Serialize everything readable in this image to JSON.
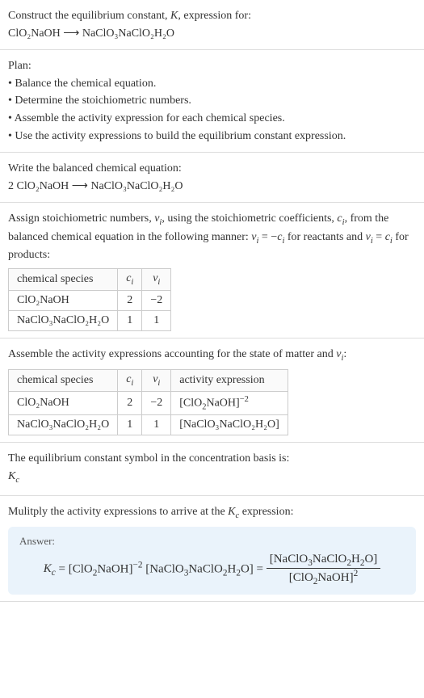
{
  "s1": {
    "l1": "Construct the equilibrium constant, K, expression for:",
    "l2": "ClO₂NaOH ⟶ NaClO₃NaClO₂H₂O"
  },
  "s2": {
    "l1": "Plan:",
    "l2": "• Balance the chemical equation.",
    "l3": "• Determine the stoichiometric numbers.",
    "l4": "• Assemble the activity expression for each chemical species.",
    "l5": "• Use the activity expressions to build the equilibrium constant expression."
  },
  "s3": {
    "l1": "Write the balanced chemical equation:",
    "l2": "2 ClO₂NaOH ⟶ NaClO₃NaClO₂H₂O"
  },
  "s4": {
    "intro": "Assign stoichiometric numbers, νᵢ, using the stoichiometric coefficients, cᵢ, from the balanced chemical equation in the following manner: νᵢ = −cᵢ for reactants and νᵢ = cᵢ for products:",
    "h1": "chemical species",
    "h2": "cᵢ",
    "h3": "νᵢ",
    "r1c1": "ClO₂NaOH",
    "r1c2": "2",
    "r1c3": "−2",
    "r2c1": "NaClO₃NaClO₂H₂O",
    "r2c2": "1",
    "r2c3": "1"
  },
  "s5": {
    "intro": "Assemble the activity expressions accounting for the state of matter and νᵢ:",
    "h1": "chemical species",
    "h2": "cᵢ",
    "h3": "νᵢ",
    "h4": "activity expression",
    "r1c1": "ClO₂NaOH",
    "r1c2": "2",
    "r1c3": "−2",
    "r1c4": "[ClO₂NaOH]⁻²",
    "r2c1": "NaClO₃NaClO₂H₂O",
    "r2c2": "1",
    "r2c3": "1",
    "r2c4": "[NaClO₃NaClO₂H₂O]"
  },
  "s6": {
    "l1": "The equilibrium constant symbol in the concentration basis is:",
    "l2": "K𝒸"
  },
  "s7": {
    "l1": "Mulitply the activity expressions to arrive at the K𝒸 expression:",
    "answerLabel": "Answer:",
    "lhs": "K𝒸 = [ClO₂NaOH]⁻² [NaClO₃NaClO₂H₂O] = ",
    "num": "[NaClO₃NaClO₂H₂O]",
    "den": "[ClO₂NaOH]²"
  }
}
